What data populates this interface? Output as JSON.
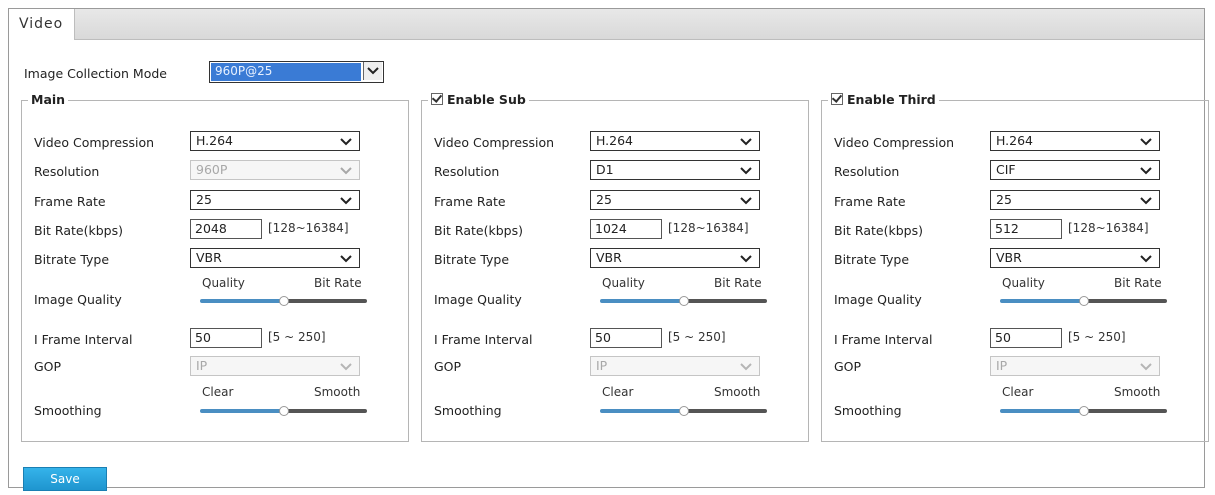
{
  "tab": {
    "label": "Video"
  },
  "image_collection": {
    "label": "Image Collection Mode",
    "value": "960P@25"
  },
  "groups": [
    {
      "legend": "Main",
      "checkbox": false,
      "video_compression": {
        "label": "Video Compression",
        "value": "H.264"
      },
      "resolution": {
        "label": "Resolution",
        "value": "960P",
        "disabled": true
      },
      "frame_rate": {
        "label": "Frame Rate",
        "value": "25"
      },
      "bit_rate": {
        "label": "Bit Rate(kbps)",
        "value": "2048",
        "range": "[128~16384]"
      },
      "bitrate_type": {
        "label": "Bitrate Type",
        "value": "VBR"
      },
      "image_quality": {
        "label": "Image Quality",
        "left": "Quality",
        "right": "Bit Rate",
        "level": 0.5
      },
      "i_frame": {
        "label": "I Frame Interval",
        "value": "50",
        "range": "[5 ~ 250]"
      },
      "gop": {
        "label": "GOP",
        "value": "IP",
        "disabled": true
      },
      "smoothing": {
        "label": "Smoothing",
        "left": "Clear",
        "right": "Smooth",
        "level": 0.5
      }
    },
    {
      "legend": "Enable Sub",
      "checkbox": true,
      "video_compression": {
        "label": "Video Compression",
        "value": "H.264"
      },
      "resolution": {
        "label": "Resolution",
        "value": "D1",
        "disabled": false
      },
      "frame_rate": {
        "label": "Frame Rate",
        "value": "25"
      },
      "bit_rate": {
        "label": "Bit Rate(kbps)",
        "value": "1024",
        "range": "[128~16384]"
      },
      "bitrate_type": {
        "label": "Bitrate Type",
        "value": "VBR"
      },
      "image_quality": {
        "label": "Image Quality",
        "left": "Quality",
        "right": "Bit Rate",
        "level": 0.5
      },
      "i_frame": {
        "label": "I Frame Interval",
        "value": "50",
        "range": "[5 ~ 250]"
      },
      "gop": {
        "label": "GOP",
        "value": "IP",
        "disabled": true
      },
      "smoothing": {
        "label": "Smoothing",
        "left": "Clear",
        "right": "Smooth",
        "level": 0.5
      }
    },
    {
      "legend": "Enable Third",
      "checkbox": true,
      "video_compression": {
        "label": "Video Compression",
        "value": "H.264"
      },
      "resolution": {
        "label": "Resolution",
        "value": "CIF",
        "disabled": false
      },
      "frame_rate": {
        "label": "Frame Rate",
        "value": "25"
      },
      "bit_rate": {
        "label": "Bit Rate(kbps)",
        "value": "512",
        "range": "[128~16384]"
      },
      "bitrate_type": {
        "label": "Bitrate Type",
        "value": "VBR"
      },
      "image_quality": {
        "label": "Image Quality",
        "left": "Quality",
        "right": "Bit Rate",
        "level": 0.5
      },
      "i_frame": {
        "label": "I Frame Interval",
        "value": "50",
        "range": "[5 ~ 250]"
      },
      "gop": {
        "label": "GOP",
        "value": "IP",
        "disabled": true
      },
      "smoothing": {
        "label": "Smoothing",
        "left": "Clear",
        "right": "Smooth",
        "level": 0.5
      }
    }
  ],
  "save": {
    "label": "Save"
  },
  "colors": {
    "accent": "#1f95cf",
    "slider_fill": "#4a8ec2",
    "slider_rest": "#555555"
  }
}
